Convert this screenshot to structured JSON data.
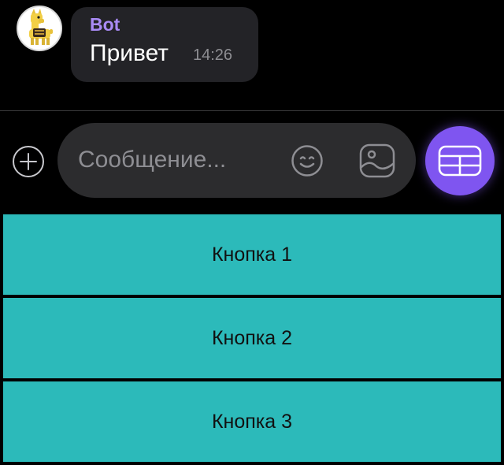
{
  "chat": {
    "message": {
      "sender": "Bot",
      "text": "Привет",
      "time": "14:26"
    }
  },
  "composer": {
    "placeholder": "Сообщение..."
  },
  "icons": {
    "attach": "plus-circle-icon",
    "emoji": "smiley-icon",
    "image": "image-icon",
    "keyboard": "keyboard-grid-icon"
  },
  "reply_keyboard": {
    "buttons": [
      {
        "label": "Кнопка 1"
      },
      {
        "label": "Кнопка 2"
      },
      {
        "label": "Кнопка 3"
      }
    ]
  },
  "colors": {
    "background": "#000000",
    "bubble": "#232327",
    "sender": "#a98bf5",
    "input_field": "#2c2c2e",
    "accent": "#7f55f0",
    "reply_button": "#2cbaba"
  }
}
